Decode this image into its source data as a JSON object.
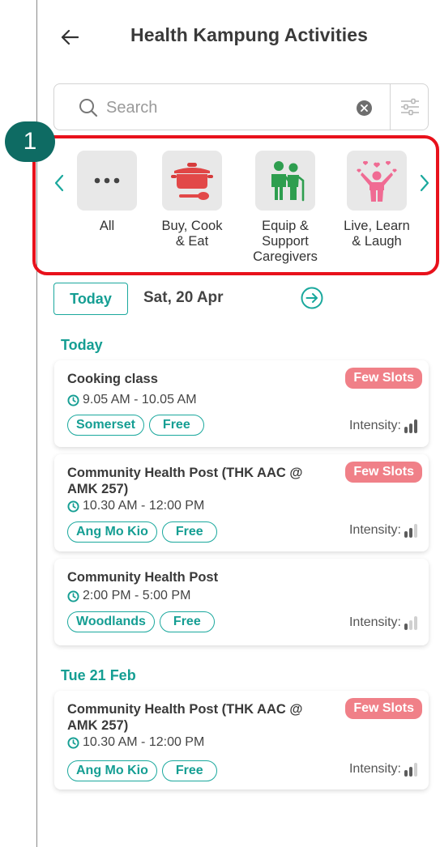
{
  "header": {
    "title": "Health Kampung Activities"
  },
  "search": {
    "placeholder": "Search",
    "value": ""
  },
  "step_badge": "1",
  "categories": [
    {
      "label": "All",
      "icon": "more-dots-icon"
    },
    {
      "label": "Buy, Cook\n& Eat",
      "icon": "cooking-pot-icon"
    },
    {
      "label": "Equip &\nSupport\nCaregivers",
      "icon": "caregiver-icon"
    },
    {
      "label": "Live, Learn\n& Laugh",
      "icon": "happy-person-hearts-icon"
    }
  ],
  "date_bar": {
    "today_label": "Today",
    "date": "Sat, 20 Apr"
  },
  "sections": [
    {
      "title": "Today",
      "activities": [
        {
          "title": "Cooking class",
          "time": "9.05 AM - 10.05 AM",
          "location": "Somerset",
          "price": "Free",
          "badge": "Few Slots",
          "intensity_label": "Intensity:",
          "intensity_level": 3
        },
        {
          "title": "Community Health Post (THK AAC @ AMK 257)",
          "time": "10.30 AM - 12:00 PM",
          "location": "Ang Mo Kio",
          "price": "Free",
          "badge": "Few Slots",
          "intensity_label": "Intensity:",
          "intensity_level": 2
        },
        {
          "title": "Community Health Post",
          "time": "2:00 PM - 5:00 PM",
          "location": "Woodlands",
          "price": "Free",
          "badge": "",
          "intensity_label": "Intensity:",
          "intensity_level": 1
        }
      ]
    },
    {
      "title": "Tue 21 Feb",
      "activities": [
        {
          "title": "Community Health Post (THK AAC @ AMK 257)",
          "time": "10.30 AM - 12:00 PM",
          "location": "Ang Mo Kio",
          "price": "Free",
          "badge": "Few Slots",
          "intensity_label": "Intensity:",
          "intensity_level": 2
        }
      ]
    }
  ],
  "colors": {
    "accent": "#1aa89d",
    "slots_badge": "#f08088",
    "highlight": "#e8111b",
    "step_badge": "#0e6b63"
  }
}
